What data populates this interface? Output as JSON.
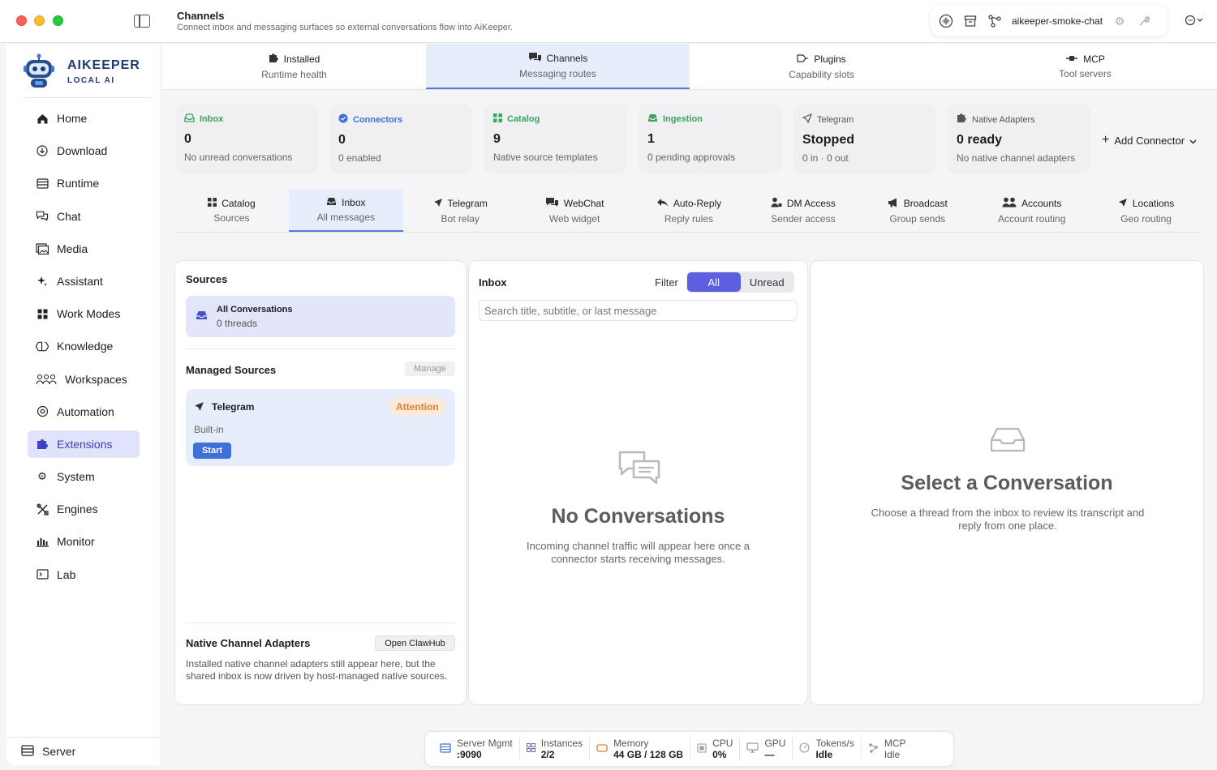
{
  "window": {
    "title": "Channels",
    "subtitle": "Connect inbox and messaging surfaces so external conversations flow into AiKeeper."
  },
  "toolbar": {
    "workspace_label": "aikeeper-smoke-chat",
    "icons": [
      "waveform-icon",
      "archive-icon",
      "branch-icon",
      "gear-icon",
      "wrench-icon",
      "more-icon"
    ]
  },
  "brand": {
    "name": "AIKEEPER",
    "tagline": "LOCAL AI",
    "color": "#1e3a6e"
  },
  "sidebar": {
    "items": [
      {
        "label": "Home",
        "icon": "home-icon"
      },
      {
        "label": "Download",
        "icon": "download-icon"
      },
      {
        "label": "Runtime",
        "icon": "runtime-icon"
      },
      {
        "label": "Chat",
        "icon": "chat-icon"
      },
      {
        "label": "Media",
        "icon": "media-icon"
      },
      {
        "label": "Assistant",
        "icon": "sparkle-icon"
      },
      {
        "label": "Work Modes",
        "icon": "grid-icon"
      },
      {
        "label": "Knowledge",
        "icon": "brain-icon"
      },
      {
        "label": "Workspaces",
        "icon": "people-icon"
      },
      {
        "label": "Automation",
        "icon": "automation-icon"
      },
      {
        "label": "Extensions",
        "icon": "puzzle-icon",
        "active": true
      },
      {
        "label": "System",
        "icon": "gear-icon"
      },
      {
        "label": "Engines",
        "icon": "tools-icon"
      },
      {
        "label": "Monitor",
        "icon": "chart-icon"
      },
      {
        "label": "Lab",
        "icon": "terminal-icon"
      }
    ],
    "bottom_label": "Server"
  },
  "top_tabs": [
    {
      "label": "Installed",
      "sub": "Runtime health",
      "icon": "puzzle-icon"
    },
    {
      "label": "Channels",
      "sub": "Messaging routes",
      "icon": "chat-bubbles-icon",
      "active": true
    },
    {
      "label": "Plugins",
      "sub": "Capability slots",
      "icon": "plug-icon"
    },
    {
      "label": "MCP",
      "sub": "Tool servers",
      "icon": "connector-icon"
    }
  ],
  "stats": [
    {
      "label": "Inbox",
      "value": "0",
      "sub": "No unread conversations",
      "color": "#3aa55e",
      "icon": "inbox-icon"
    },
    {
      "label": "Connectors",
      "value": "0",
      "sub": "0 enabled",
      "color": "#3f6fd8",
      "icon": "check-circle-icon"
    },
    {
      "label": "Catalog",
      "value": "9",
      "sub": "Native source templates",
      "color": "#3aa55e",
      "icon": "grid-icon"
    },
    {
      "label": "Ingestion",
      "value": "1",
      "sub": "0 pending approvals",
      "color": "#3aa55e",
      "icon": "tray-icon"
    },
    {
      "label": "Telegram",
      "value": "Stopped",
      "sub": "0 in · 0 out",
      "color": "#555555",
      "icon": "send-icon"
    },
    {
      "label": "Native Adapters",
      "value": "0 ready",
      "sub": "No native channel adapters",
      "color": "#555555",
      "icon": "puzzle-icon"
    }
  ],
  "add_connector": "Add Connector",
  "sub_tabs": [
    {
      "label": "Catalog",
      "sub": "Sources",
      "icon": "grid-icon"
    },
    {
      "label": "Inbox",
      "sub": "All messages",
      "icon": "inbox-icon",
      "active": true
    },
    {
      "label": "Telegram",
      "sub": "Bot relay",
      "icon": "send-icon"
    },
    {
      "label": "WebChat",
      "sub": "Web widget",
      "icon": "chat-bubbles-icon"
    },
    {
      "label": "Auto-Reply",
      "sub": "Reply rules",
      "icon": "reply-icon"
    },
    {
      "label": "DM Access",
      "sub": "Sender access",
      "icon": "person-lock-icon"
    },
    {
      "label": "Broadcast",
      "sub": "Group sends",
      "icon": "megaphone-icon"
    },
    {
      "label": "Accounts",
      "sub": "Account routing",
      "icon": "people-icon"
    },
    {
      "label": "Locations",
      "sub": "Geo routing",
      "icon": "location-icon"
    }
  ],
  "sources_panel": {
    "title": "Sources",
    "all_title": "All Conversations",
    "all_sub": "0 threads",
    "managed_title": "Managed Sources",
    "manage_label": "Manage",
    "source": {
      "name": "Telegram",
      "badge": "Attention",
      "type": "Built-in",
      "start_label": "Start"
    },
    "native_title": "Native Channel Adapters",
    "open_label": "Open ClawHub",
    "native_desc": "Installed native channel adapters still appear here, but the shared inbox is now driven by host-managed native sources."
  },
  "inbox_panel": {
    "title": "Inbox",
    "filter_label": "Filter",
    "filter_all": "All",
    "filter_unread": "Unread",
    "search_placeholder": "Search title, subtitle, or last message",
    "empty_title": "No Conversations",
    "empty_desc": "Incoming channel traffic will appear here once a connector starts receiving messages."
  },
  "detail_panel": {
    "title": "Select a Conversation",
    "desc": "Choose a thread from the inbox to review its transcript and reply from one place."
  },
  "status_bar": [
    {
      "label": "Server Mgmt",
      "value": ":9090",
      "icon": "server-icon"
    },
    {
      "label": "Instances",
      "value": "2/2",
      "icon": "grid-icon"
    },
    {
      "label": "Memory",
      "value": "44 GB / 128 GB",
      "icon": "memory-icon"
    },
    {
      "label": "CPU",
      "value": "0%",
      "icon": "cpu-icon"
    },
    {
      "label": "GPU",
      "value": "—",
      "icon": "monitor-icon"
    },
    {
      "label": "Tokens/s",
      "value": "Idle",
      "icon": "gauge-icon"
    },
    {
      "label": "MCP",
      "value": "Idle",
      "icon": "connector-icon"
    }
  ]
}
